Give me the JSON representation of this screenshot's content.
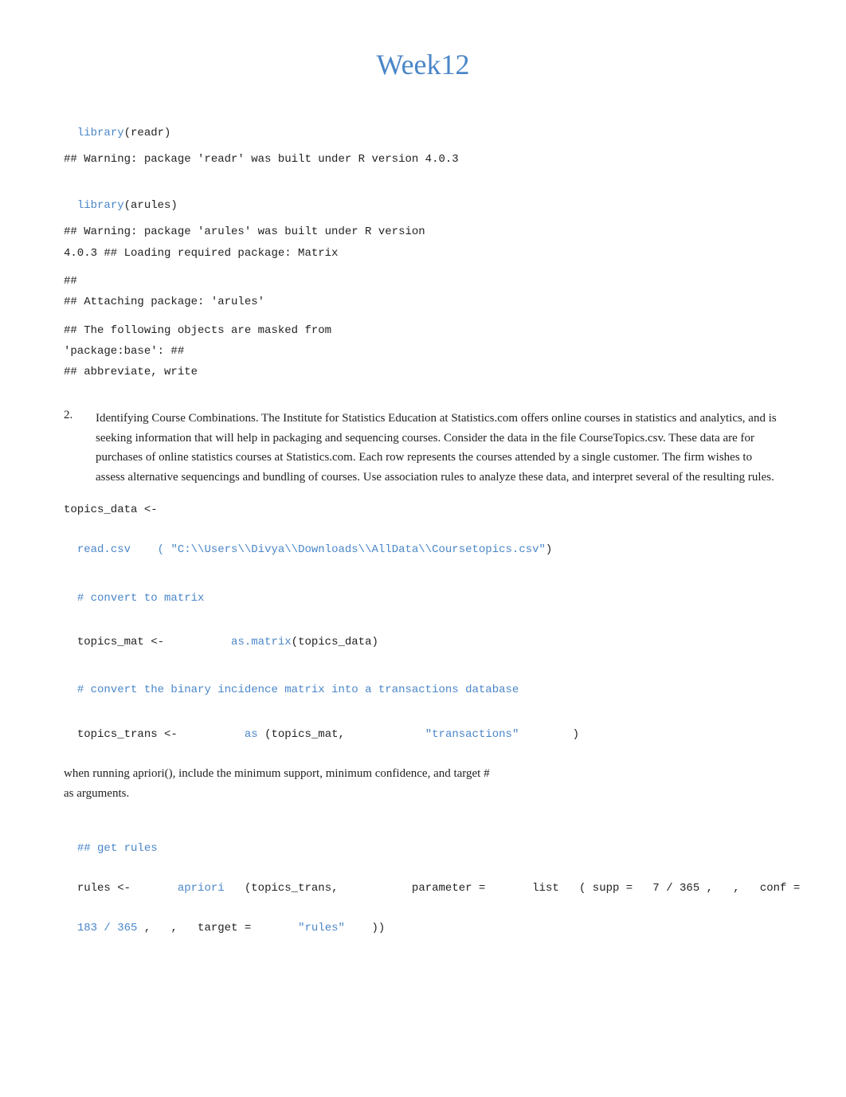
{
  "title": "Week12",
  "sections": {
    "library1": {
      "keyword": "library",
      "arg": "(readr)"
    },
    "warning1": "## Warning: package 'readr' was built under R version 4.0.3",
    "library2": {
      "keyword": "library",
      "arg": "(arules)"
    },
    "warning2_line1": "## Warning: package 'arules' was built under R version",
    "warning2_line2": "4.0.3 ## Loading required package: Matrix",
    "warning3_line1": "##",
    "warning3_line2": "## Attaching package: 'arules'",
    "warning4_line1": "## The following objects are masked from",
    "warning4_line2": "'package:base': ##",
    "warning4_line3": "##          abbreviate, write",
    "item2": {
      "number": "2.",
      "text": "Identifying Course Combinations. The Institute for Statistics Education at Statistics.com offers online courses in statistics and analytics, and is seeking information that will help in packaging and sequencing courses. Consider the data in the file CourseTopics.csv. These data are for purchases of online statistics courses at Statistics.com. Each row represents the courses attended by a single customer. The firm wishes to assess alternative sequencings and bundling of courses. Use association rules to analyze these data, and interpret several of the resulting rules."
    },
    "code": {
      "topics_data_assign": "topics_data <-",
      "read_csv_kw": "read.csv",
      "read_csv_path": "( \"C:\\\\Users\\\\Divya\\\\Downloads\\\\AllData\\\\Coursetopics.csv\"",
      "read_csv_close": ")",
      "comment_matrix": "# convert to matrix",
      "topics_mat_assign": "topics_mat <-",
      "as_matrix_kw": "as.matrix",
      "topics_mat_arg": "(topics_data)",
      "comment_trans": "# convert the binary incidence matrix into a transactions database",
      "topics_trans_assign": "topics_trans <-",
      "as_kw": "as",
      "topics_trans_arg": "(topics_mat,",
      "transactions_str": "\"transactions\"",
      "topics_trans_close": ")",
      "prose_apriori": "when running apriori(), include the minimum support, minimum confidence, and target #\nas arguments.",
      "comment_rules": "## get rules",
      "rules_assign": "rules <-",
      "apriori_kw": "apriori",
      "apriori_args": "(topics_trans,",
      "parameter_kw": "parameter =",
      "list_kw": "list",
      "supp_label": "( supp =",
      "supp_val": "7 / 365",
      "conf_label": ",   conf =",
      "conf_val1": "183 / 365",
      "target_label": ",   target =",
      "target_str": "\"rules\"",
      "rules_close": "))"
    }
  }
}
